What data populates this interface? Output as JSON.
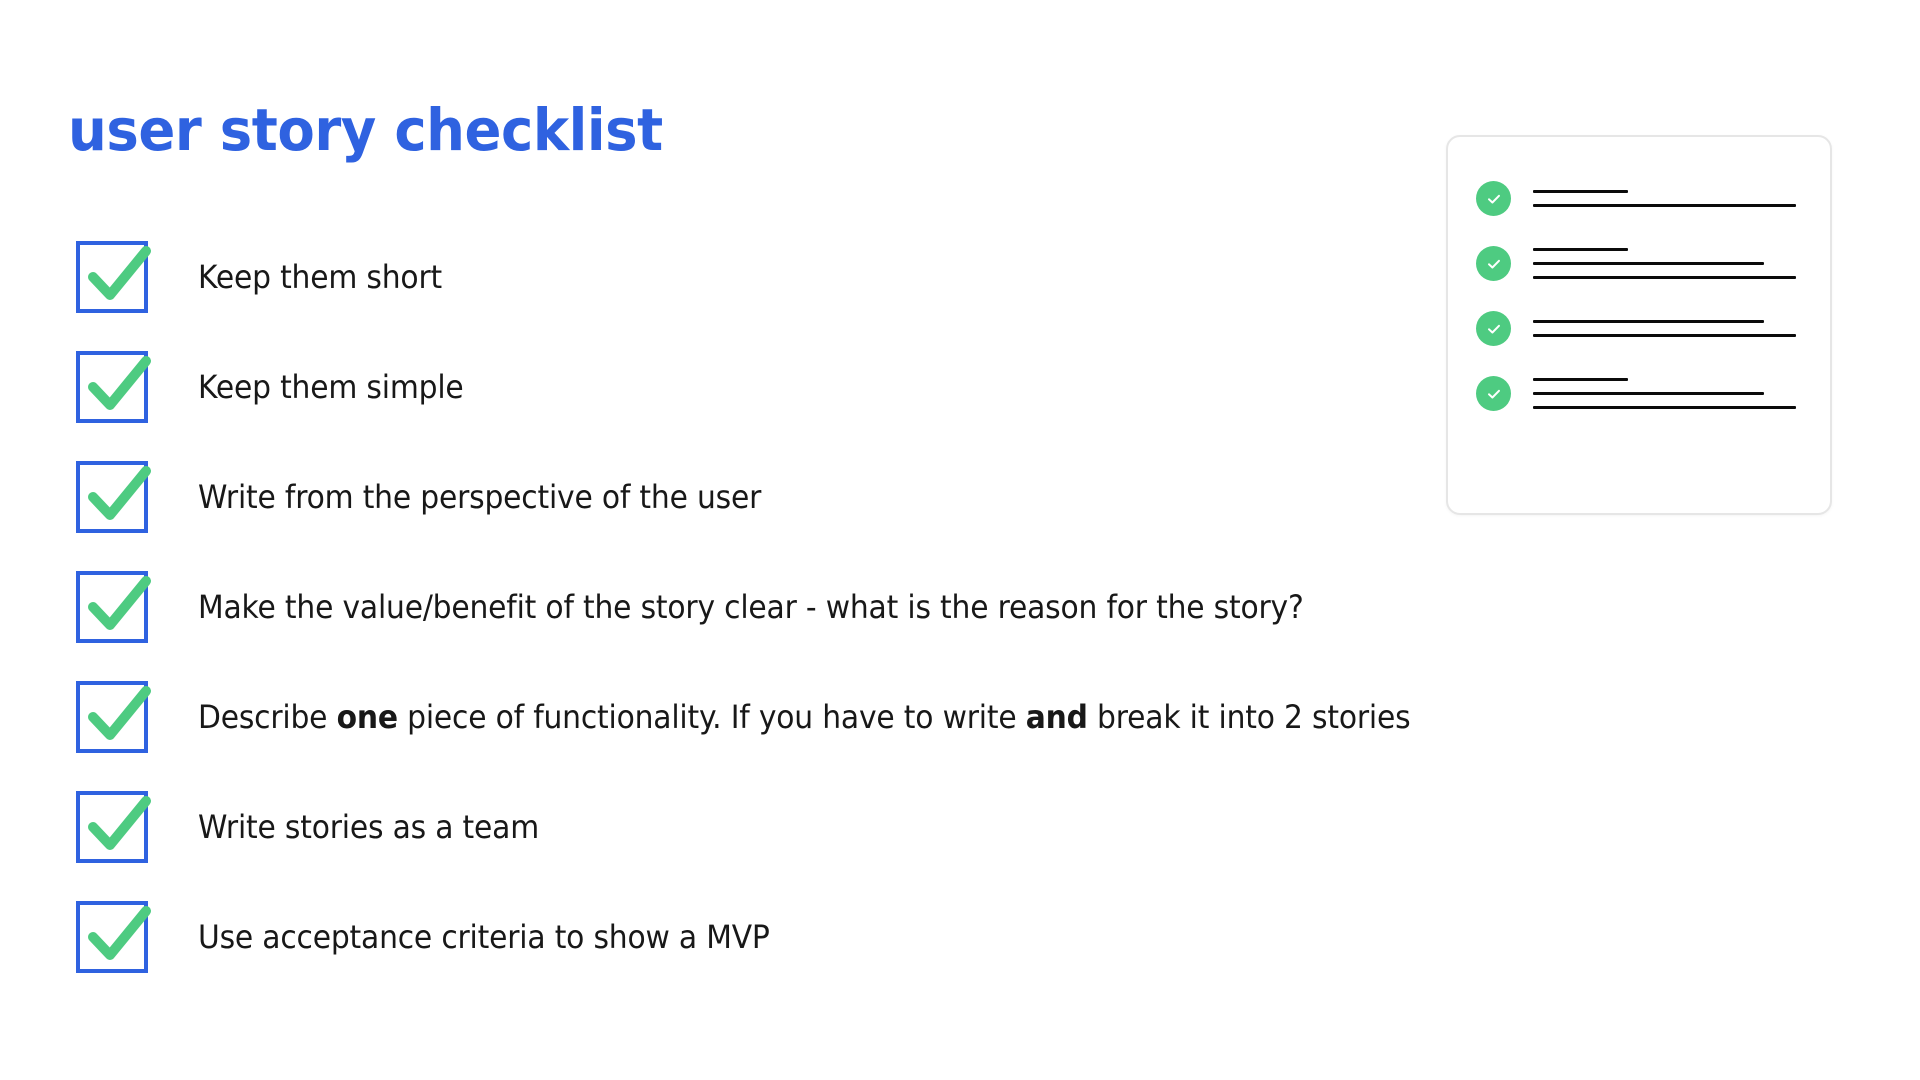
{
  "page": {
    "title": "user story checklist",
    "background": "#ffffff",
    "accent_blue": "#2f62e0",
    "accent_green": "#4ecb81",
    "text_color": "#181818"
  },
  "checklist": {
    "items": [
      {
        "id": "keep-them-short",
        "checked": true,
        "segments": [
          {
            "text": "Keep them short",
            "bold": false
          }
        ]
      },
      {
        "id": "keep-them-simple",
        "checked": true,
        "segments": [
          {
            "text": "Keep them simple",
            "bold": false
          }
        ]
      },
      {
        "id": "write-from-perspective-of-user",
        "checked": true,
        "segments": [
          {
            "text": "Write from the perspective of the user",
            "bold": false
          }
        ]
      },
      {
        "id": "make-value-benefit-clear",
        "checked": true,
        "segments": [
          {
            "text": "Make the value/benefit of the story clear - what is the reason for the story?",
            "bold": false
          }
        ]
      },
      {
        "id": "describe-one-piece-of-functionality",
        "checked": true,
        "segments": [
          {
            "text": "Describe ",
            "bold": false
          },
          {
            "text": "one",
            "bold": true
          },
          {
            "text": " piece of functionality. If you have to write ",
            "bold": false
          },
          {
            "text": "and",
            "bold": true
          },
          {
            "text": " break it into 2 stories",
            "bold": false
          }
        ]
      },
      {
        "id": "write-stories-as-a-team",
        "checked": true,
        "segments": [
          {
            "text": "Write stories as a team",
            "bold": false
          }
        ]
      },
      {
        "id": "use-acceptance-criteria-mvp",
        "checked": true,
        "segments": [
          {
            "text": "Use acceptance criteria to show a MVP",
            "bold": false
          }
        ]
      }
    ]
  },
  "mini_card": {
    "icon": "check-circle-icon",
    "rows": [
      {
        "id": "mini-row-1",
        "checked": true,
        "lines": [
          "sm",
          "xl"
        ]
      },
      {
        "id": "mini-row-2",
        "checked": true,
        "lines": [
          "sm",
          "lg",
          "xl"
        ]
      },
      {
        "id": "mini-row-3",
        "checked": true,
        "lines": [
          "lg",
          "xl"
        ]
      },
      {
        "id": "mini-row-4",
        "checked": true,
        "lines": [
          "sm",
          "lg",
          "xl"
        ]
      }
    ]
  }
}
